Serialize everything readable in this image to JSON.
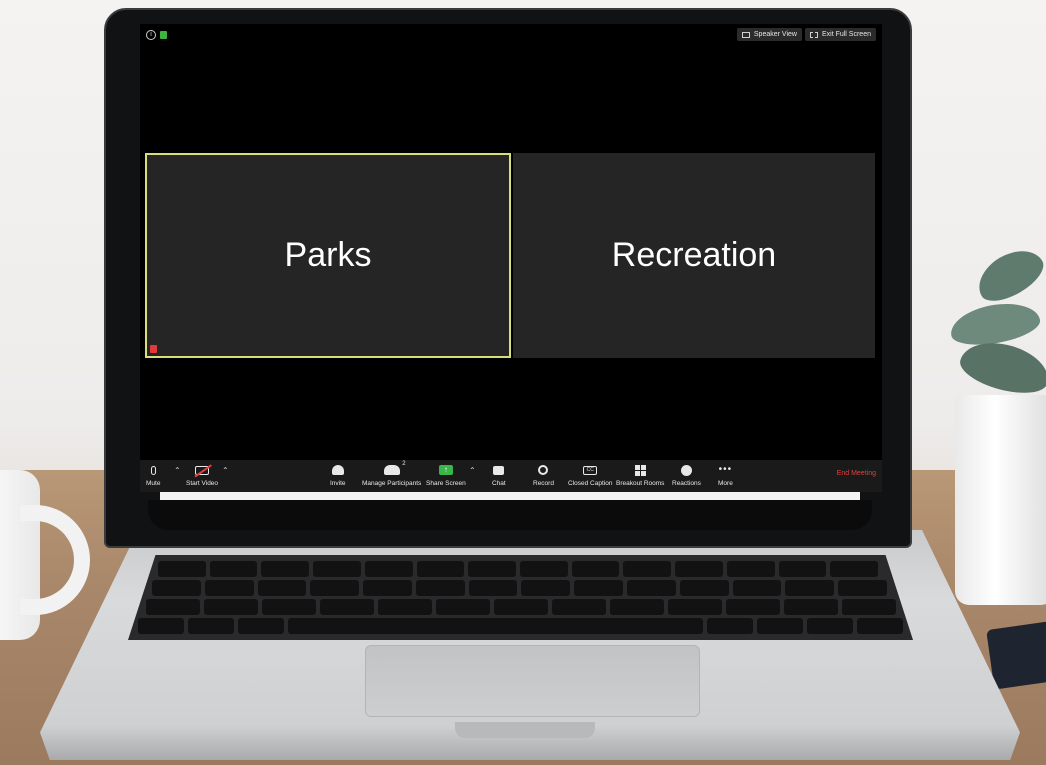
{
  "window": {
    "top_bar": {
      "speaker_view_label": "Speaker View",
      "exit_full_screen_label": "Exit Full Screen",
      "info_icon": "info-icon",
      "security_icon": "lock-icon"
    }
  },
  "participants": [
    {
      "name": "Parks",
      "active_speaker": true,
      "muted": true
    },
    {
      "name": "Recreation",
      "active_speaker": false,
      "muted": false
    }
  ],
  "toolbar": {
    "mute_label": "Mute",
    "start_video_label": "Start Video",
    "invite_label": "Invite",
    "manage_participants_label": "Manage Participants",
    "participant_count": "2",
    "share_screen_label": "Share Screen",
    "chat_label": "Chat",
    "record_label": "Record",
    "closed_caption_label": "Closed Caption",
    "cc_glyph": "CC",
    "breakout_rooms_label": "Breakout Rooms",
    "reactions_label": "Reactions",
    "more_label": "More",
    "end_meeting_label": "End Meeting"
  },
  "colors": {
    "active_speaker_border": "#d9dd7a",
    "share_green": "#39b54a",
    "end_meeting_red": "#e0403f",
    "tile_bg": "#252525"
  }
}
